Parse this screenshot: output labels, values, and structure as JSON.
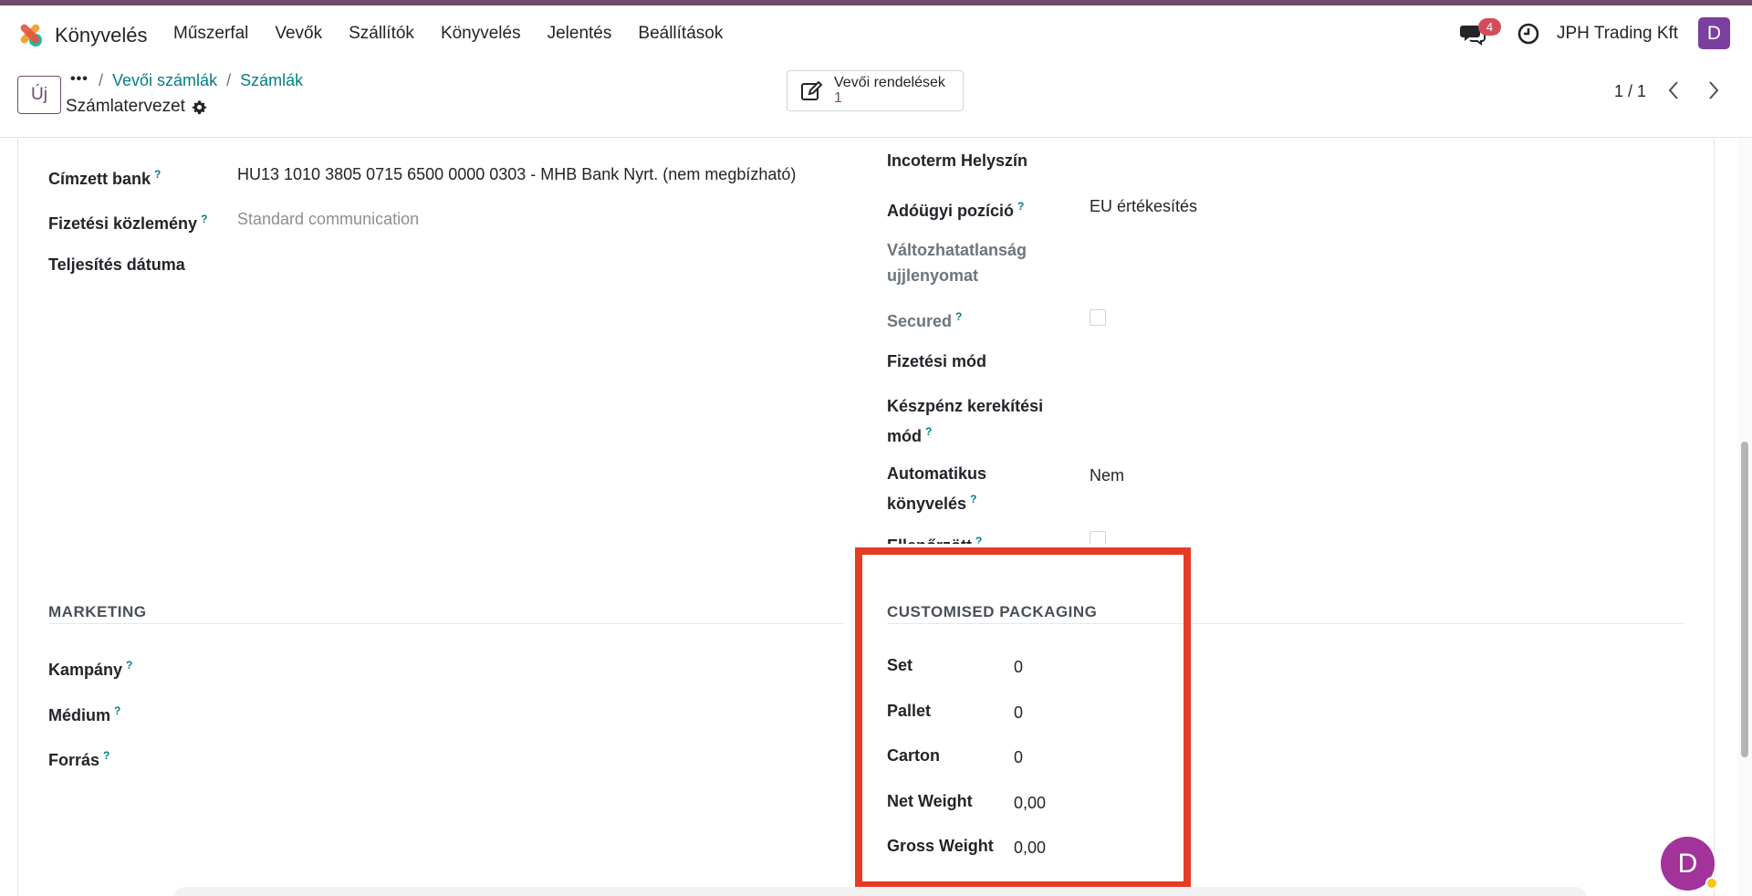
{
  "app": {
    "name": "Könyvelés",
    "menu": [
      "Műszerfal",
      "Vevők",
      "Szállítók",
      "Könyvelés",
      "Jelentés",
      "Beállítások"
    ],
    "chat_count": "4",
    "company": "JPH Trading Kft",
    "user_initial": "D"
  },
  "control": {
    "new_label": "Új",
    "more_label": "•••",
    "breadcrumbs": [
      "Vevői számlák",
      "Számlák"
    ],
    "record_title": "Számlatervezet",
    "smart_button": {
      "label": "Vevői rendelések",
      "count": "1"
    },
    "pager": "1 / 1"
  },
  "left_fields": {
    "recipient_bank": {
      "label": "Címzett bank",
      "help": "?",
      "value": "HU13 1010 3805 0715 6500 0000 0303 - MHB Bank Nyrt. (nem megbízható)"
    },
    "payment_reference": {
      "label": "Fizetési közlemény",
      "help": "?",
      "placeholder": "Standard communication"
    },
    "delivery_date": {
      "label": "Teljesítés dátuma"
    }
  },
  "right_fields": {
    "incoterm_location": {
      "label": "Incoterm Helyszín"
    },
    "fiscal_position": {
      "label": "Adóügyi pozíció",
      "help": "?",
      "value": "EU értékesítés"
    },
    "immutability": {
      "label_line1": "Változhatatlanság",
      "label_line2": "ujjlenyomat"
    },
    "secured": {
      "label": "Secured",
      "help": "?"
    },
    "payment_method": {
      "label": "Fizetési mód"
    },
    "cash_rounding": {
      "label_line1": "Készpénz kerekítési",
      "label_line2": "mód",
      "help": "?"
    },
    "auto_post": {
      "label_line1": "Automatikus",
      "label_line2": "könyvelés",
      "help": "?",
      "value": "Nem"
    },
    "checked": {
      "label": "Ellenőrzött",
      "help": "?"
    }
  },
  "marketing": {
    "title": "MARKETING",
    "campaign": {
      "label": "Kampány",
      "help": "?"
    },
    "medium": {
      "label": "Médium",
      "help": "?"
    },
    "source": {
      "label": "Forrás",
      "help": "?"
    }
  },
  "packaging": {
    "title": "CUSTOMISED PACKAGING",
    "set": {
      "label": "Set",
      "value": "0"
    },
    "pallet": {
      "label": "Pallet",
      "value": "0"
    },
    "carton": {
      "label": "Carton",
      "value": "0"
    },
    "net_weight": {
      "label": "Net Weight",
      "value": "0,00"
    },
    "gross_weight": {
      "label": "Gross Weight",
      "value": "0,00"
    }
  },
  "colors": {
    "brand": "#714B67",
    "link": "#017e84",
    "highlight": "#e63b25",
    "avatar": "#a1339b"
  },
  "icons": [
    "app-logo-icon",
    "chat-icon",
    "clock-icon",
    "gear-icon",
    "edit-icon",
    "chevron-left-icon",
    "chevron-right-icon"
  ]
}
